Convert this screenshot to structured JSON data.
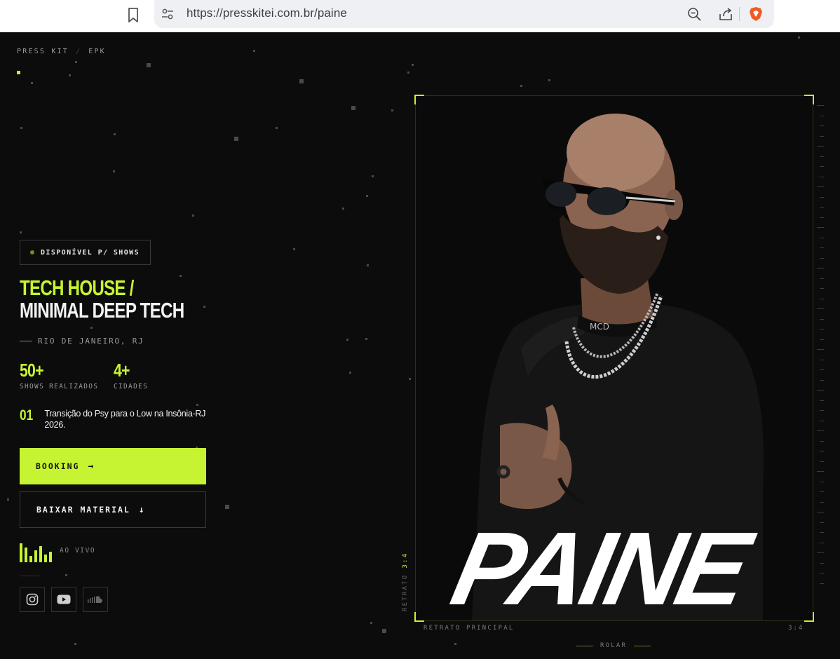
{
  "browser": {
    "url": "https://presskitei.com.br/paine",
    "icons": [
      "bookmark-icon",
      "site-settings-icon",
      "zoom-out-icon",
      "share-icon",
      "brave-shield-icon"
    ]
  },
  "breadcrumb": {
    "part1": "PRESS KIT",
    "separator": "/",
    "part2": "EPK"
  },
  "availability_badge": "DISPONÍVEL P/ SHOWS",
  "genre": {
    "line1": "TECH HOUSE /",
    "line2": "MINIMAL DEEP TECH"
  },
  "location": "RIO DE JANEIRO, RJ",
  "stats": [
    {
      "value": "50+",
      "label": "SHOWS REALIZADOS"
    },
    {
      "value": "4+",
      "label": "CIDADES"
    }
  ],
  "highlight": {
    "number": "01",
    "text": "Transição do Psy para o Low na Insônia-RJ 2026."
  },
  "buttons": {
    "booking": "BOOKING",
    "booking_arrow": "→",
    "download": "BAIXAR MATERIAL",
    "download_arrow": "↓"
  },
  "live": {
    "label": "AO VIVO",
    "bar_levels": [
      0.9,
      0.7,
      0.3,
      0.55,
      0.75,
      0.35,
      0.5
    ]
  },
  "social": [
    "instagram-icon",
    "youtube-icon",
    "soundcloud-icon"
  ],
  "portrait": {
    "logo_text": "PAINE",
    "shirt_text": "MCD",
    "side_label": "RETRATO",
    "side_ratio": "3:4",
    "caption_left": "RETRATO PRINCIPAL",
    "caption_right": "3:4"
  },
  "scroll_hint": "ROLAR",
  "colors": {
    "accent": "#c6f432",
    "background": "#0c0c0c",
    "text": "#f0f0f0",
    "muted": "#9a9a9a"
  }
}
